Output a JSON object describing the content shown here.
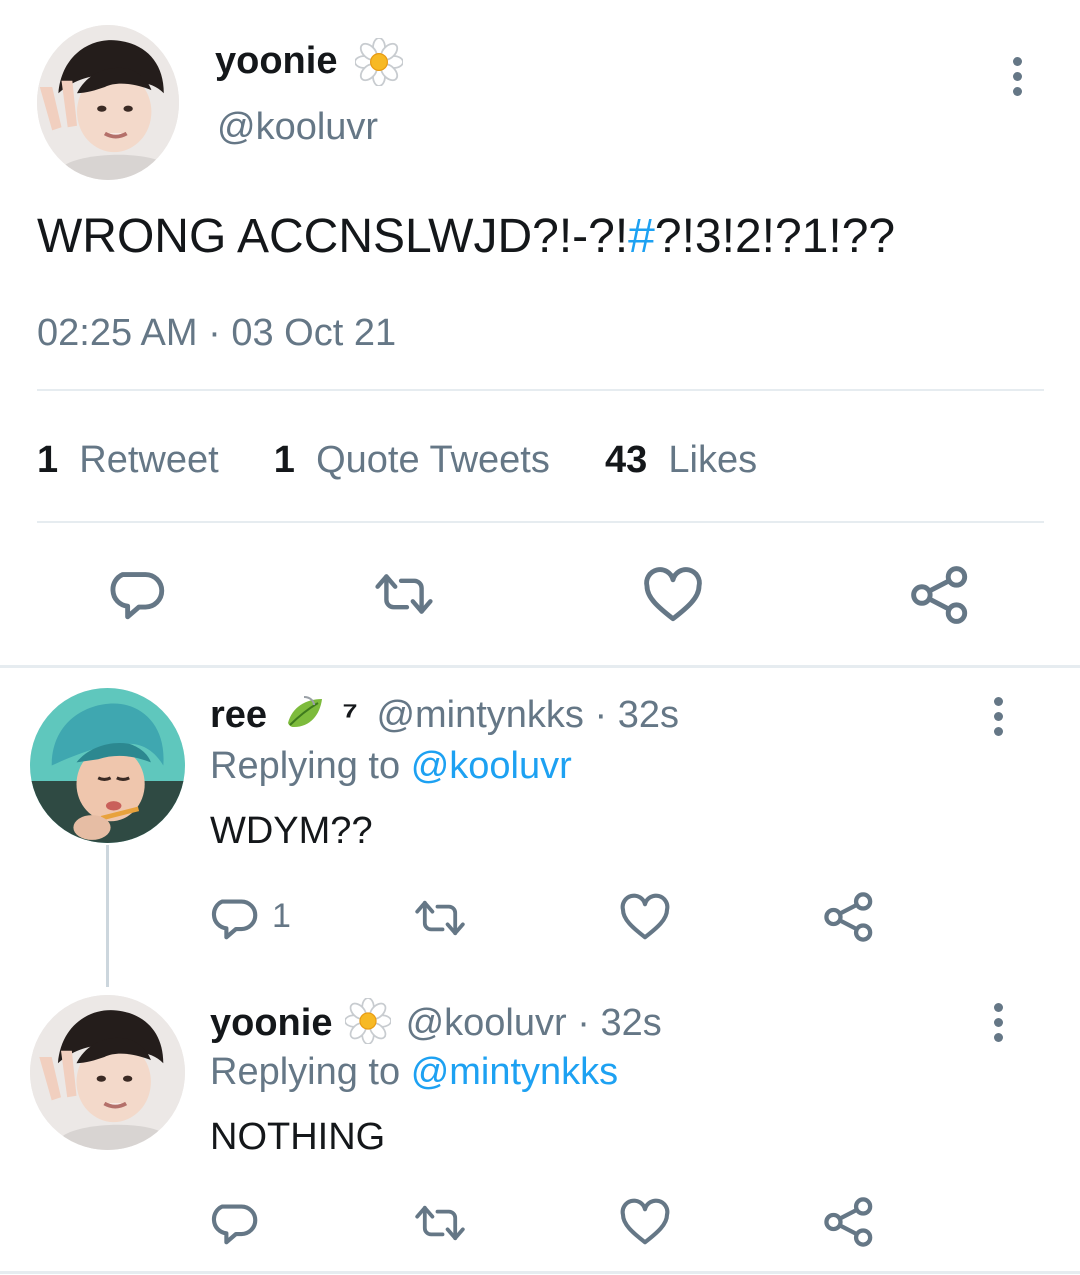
{
  "main_tweet": {
    "display_name": "yoonie",
    "handle": "@kooluvr",
    "text_before": "WRONG ACCNSLWJD?!-?!",
    "text_hash": "#",
    "text_after": "?!3!2!?1!??",
    "time": "02:25 AM",
    "date_sep": " · ",
    "date": "03 Oct 21",
    "stats": {
      "retweet_count": "1",
      "retweet_label": "Retweet",
      "quote_count": "1",
      "quote_label": "Quote Tweets",
      "like_count": "43",
      "like_label": "Likes"
    }
  },
  "replies": [
    {
      "display_name": "ree",
      "badge_text": "⁷",
      "handle": "@mintynkks",
      "time_sep": " · ",
      "time": "32s",
      "replying_label": "Replying to",
      "replying_to": "@kooluvr",
      "text": "WDYM??",
      "reply_count": "1"
    },
    {
      "display_name": "yoonie",
      "handle": "@kooluvr",
      "time_sep": " · ",
      "time": "32s",
      "replying_label": "Replying to",
      "replying_to": "@mintynkks",
      "text": "NOTHING",
      "reply_count": ""
    }
  ],
  "icons": {
    "reply": "reply-icon",
    "retweet": "retweet-icon",
    "like": "heart-icon",
    "share": "share-icon",
    "more": "more-vertical-icon",
    "flower": "daisy-emoji-icon",
    "leaf": "leaf-emoji-icon"
  },
  "colors": {
    "link": "#1da1f2",
    "muted": "#657786",
    "text": "#14171a",
    "divider": "#e6ecf0"
  }
}
